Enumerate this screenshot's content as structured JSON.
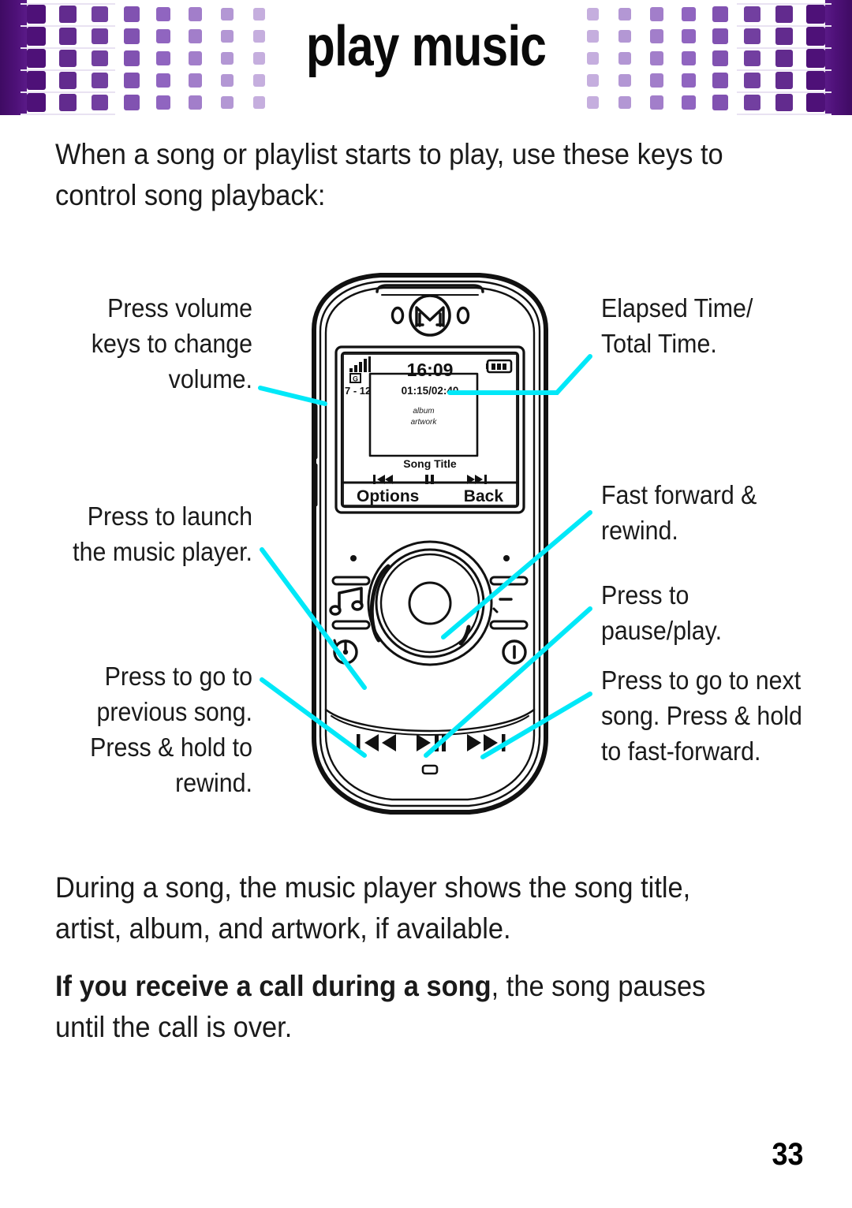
{
  "page": {
    "title": "play music",
    "number": "33",
    "accent_purple_dark": "#4e1178",
    "accent_purple_light": "#8e63bf",
    "leader_color": "#00e8f8"
  },
  "intro_paragraph": "When a song or playlist starts to play, use these keys to control song playback:",
  "closing_paragraphs": {
    "p1": "During a song, the music player shows the song title, artist, album, and artwork, if available.",
    "p2_bold": "If you receive a call during a song",
    "p2_rest": ", the song pauses until the call is over."
  },
  "callouts": {
    "left": [
      {
        "id": "volume",
        "text": "Press volume keys to change volume."
      },
      {
        "id": "launch-player",
        "text": "Press to launch the music player."
      },
      {
        "id": "previous-song",
        "text": "Press to go to previous song. Press & hold to rewind."
      }
    ],
    "right": [
      {
        "id": "elapsed-total-time",
        "text": "Elapsed Time/ Total Time."
      },
      {
        "id": "fast-forward-rewind",
        "text": "Fast forward & rewind."
      },
      {
        "id": "pause-play",
        "text": "Press to pause/play."
      },
      {
        "id": "next-song",
        "text": "Press to go to next song. Press & hold to fast-forward."
      }
    ]
  },
  "phone": {
    "brand_mark": "motorola-batwing-logo",
    "left_mark": "0",
    "right_mark": "0",
    "screen": {
      "signal_icon": "signal-bars-icon",
      "network_label": "G",
      "channel": "7 - 12",
      "clock": "16:09",
      "battery_icon": "battery-full-icon",
      "track_time": "01:15/02:40",
      "artwork_line1": "album",
      "artwork_line2": "artwork",
      "song_title": "Song Title",
      "transport": {
        "previous": "previous-track-icon",
        "pause": "pause-icon",
        "next": "next-track-icon"
      },
      "softkey_left": "Options",
      "softkey_right": "Back"
    },
    "keypad": {
      "music_key": "music-note-key",
      "call_key": "call-send-key",
      "power_key": "power-end-key",
      "media_previous": "media-previous-rewind-key",
      "media_playpause": "media-play-pause-key",
      "media_next": "media-next-fastforward-key"
    }
  }
}
